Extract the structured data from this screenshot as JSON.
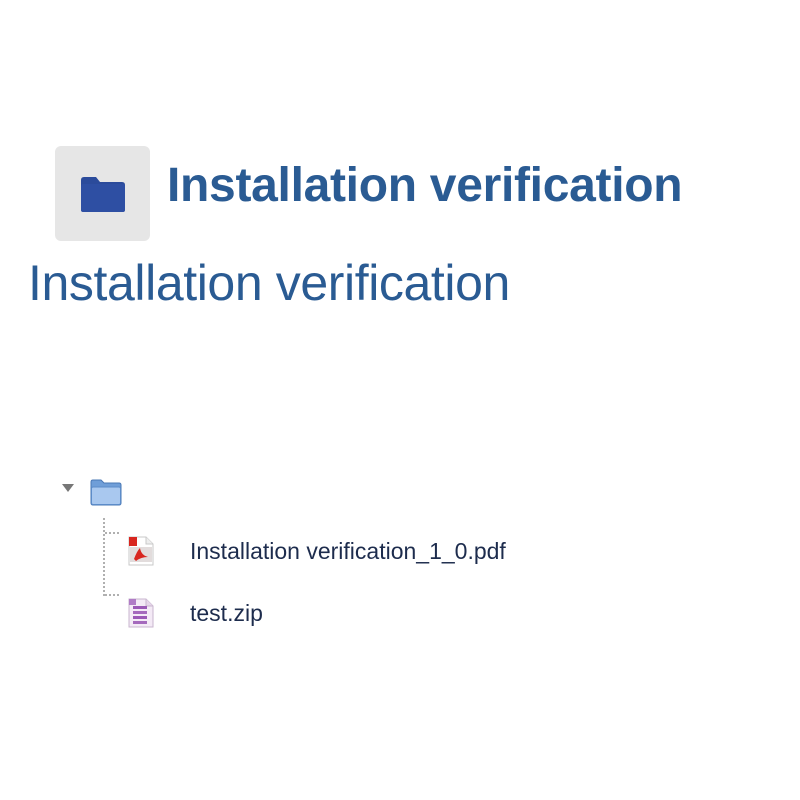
{
  "header": {
    "title": "Installation verification",
    "icon": "folder-icon",
    "icon_color": "#2b4b9b"
  },
  "page": {
    "heading": "Installation verification"
  },
  "tree": {
    "toggle_icon": "triangle-down-icon",
    "root_icon": "folder-open-icon",
    "files": [
      {
        "name": "Installation verification_1_0.pdf",
        "icon": "pdf-file-icon"
      },
      {
        "name": "test.zip",
        "icon": "archive-file-icon"
      }
    ]
  },
  "colors": {
    "title": "#2a5b93",
    "link": "#1d2c4d",
    "icon_bg": "#e6e6e6"
  }
}
